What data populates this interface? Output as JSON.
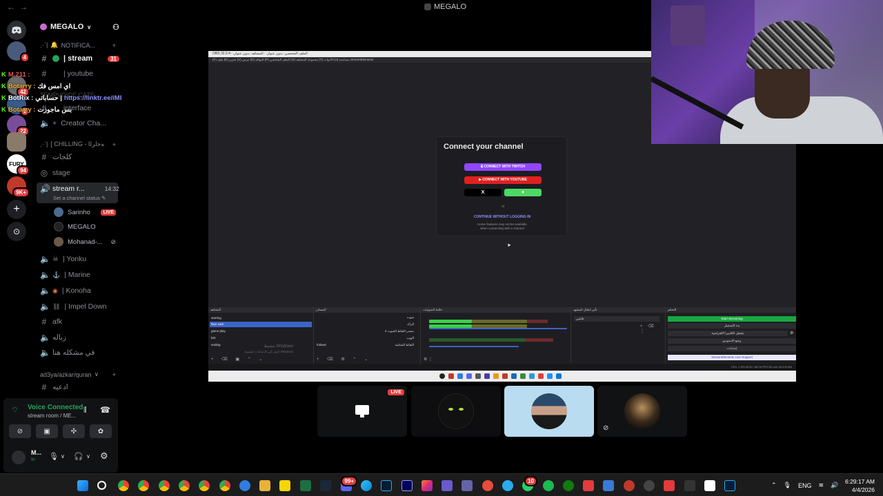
{
  "window": {
    "title": "MEGALO",
    "nav_back": "←",
    "nav_forward": "→"
  },
  "server": {
    "name": "MEGALO",
    "chevron": "∨"
  },
  "rail_badges": [
    "4",
    "42",
    "1",
    "22",
    "94",
    "9K+"
  ],
  "rail_labels": {
    "fury": "FURY"
  },
  "categories": {
    "notifications": "NOTIFICA...",
    "temp_voice": "TEMPVOICE CATE...",
    "chilling": "[ CHILLING - ﻪﺣﺍﺮﻟﺍ",
    "quran": "ad3ya/azkar/quran"
  },
  "channels": {
    "stream": {
      "name": "| stream",
      "count": "31"
    },
    "youtube": "| youtube",
    "interface": "interface",
    "creator": "Creator Cha...",
    "kalajat": "ﻛﻠﺠﺎﺕ",
    "stage": "stage",
    "stream_room": {
      "name": "stream r...",
      "time": "14:32",
      "status": "Set a channel status"
    },
    "yonku": "| Yonku",
    "marine": "| Marine",
    "konoha": "| Konoha",
    "impel": "| Impel Down",
    "afk": "afk",
    "zbala": "ﺯﺑﺎﻟﻪ",
    "mushkila": "ﻓﻲ ﻣﺸﻜﻠﻪ ﻫﻨﺎ",
    "adeia": "ﺍﺩﻋﻴﻪ"
  },
  "users": {
    "sarinho": "Sarinho",
    "live": "LIVE",
    "megalo": "MEGALO",
    "mohanad": "Mohanad-..."
  },
  "chat": [
    {
      "user": "M.211 :",
      "msg": "ﺍﻱ ﺍﻣﺲ ﻓﻚ",
      "color": "#e05a5a"
    },
    {
      "user": "Botarry :",
      "msg": "",
      "color": "#f0b232"
    },
    {
      "user": "BotRix :",
      "msg": "ﺣﺴﺎﺑﺎﺗﻲ | https://linktr.ee/iMEGALO",
      "color": "#ffffff",
      "link_color": "#8e90ff"
    },
    {
      "user": "Botarry :",
      "msg": "ﺑﺲ ﻣﺎﺟﻮﺯﺕ",
      "color": "#f0b232"
    }
  ],
  "voice": {
    "title": "Voice Connected",
    "sub": "stream room / ME...",
    "user": "M...",
    "status": "In"
  },
  "obs": {
    "topbar": "OBS 32.0.4 - ﺍﻟﻤﻠﻒ ﺍﻟﺸﺨﺼﻲ: ﺑﺪﻭﻥ ﻋﻨﻮﺍﻥ - ﺍﻟﻤﺸﺎﻫﺪ: ﺑﺪﻭﻥ ﻋﻨﻮﺍﻥ",
    "menu": "(F) ﻣﻠﻒ   (E) ﺗﺤﺮﻳﺮ   (V) ﻋﺮﺽ   (D) ﺍﻟﻨﻮﺍﻓﺬ   (P) ﺍﻟﻤﻠﻒ ﺍﻟﺸﺨﺼﻲ   (S) ﻣﺠﻤﻮﻋﺔ ﺍﻟﻤﺸﺎﻫﺪ   (T) ﺍﻷﺩﻭﺍﺕ   (H) ﻣﺴﺎﻋﺪﺓ   StreamElements",
    "connect": {
      "title": "Connect your channel",
      "twitch": "CONNECT WITH TWITCH",
      "youtube": "CONNECT WITH YOUTUBE",
      "x": "X",
      "or": "or",
      "continue": "CONTINUE WITHOUT LOGGING IN",
      "note1": "Some features may not be available",
      "note2": "when connecting with a channel"
    },
    "docks": {
      "scenes_header": "ﺍﻟﻤﺸﺎﻫﺪ",
      "sources_header": "ﺍﻟﻤﺼﺎﺩﺭ",
      "mixer_header": "ﺧﻼﻁ ﺍﻟﺼﻮﺗﻴﺎﺕ",
      "transitions_header": "ﺗﺄﺛﻴﺮ ﺍﻧﺘﻘﺎﻝ ﺍﻟﻤﺸﻬﺪ",
      "controls_header": "ﺍﻟﺘﺤﻜﻢ",
      "scenes": [
        "starting",
        "face cam",
        "game play",
        "brb",
        "ending"
      ],
      "selected_scene": 1,
      "sources": [
        "ﺻﻮﺕ",
        "ﺍﻟﺮﺍﻙ",
        "ﻣﺼﺪﺭ ﺍﻟﺘﻘﺎﻁ ﺍﻟﺼﻮﺕ 2",
        "ﺍﻟﻮﻳﺐ",
        "follows",
        "ﺍﻟﺘﻘﺎﻁ ﺍﻟﺸﺎﺷﺔ"
      ],
      "start_streaming": "Start Streaming",
      "controls": [
        "ﺑﺪﺀ ﺍﻟﺘﺴﺠﻴﻞ",
        "ﺗﺸﻐﻴﻞ ﺍﻟﻜﺎﻣﻴﺮﺍ ﺍﻻﻓﺘﺮﺍﺿﻴﺔ",
        "ﻭﺿﻊ ﺍﻻﺳﺘﻮﺩﻳﻮ",
        "ﺇﻋﺪﺍﺩﺍﺕ"
      ],
      "se_support": "StreamElements Live Support",
      "fade": "ﺗﻼﺷﻲ"
    },
    "status": "CPU: 2.9%   60.00 / 60.00 FPS   35 Live: 00:2:5:549",
    "watermark1": "ﺗﻨﺸﻴﻂ Windows",
    "watermark2": "ﺍﻧﺘﻘﻞ ﺇﻟﻰ ﺍﻹﻋﺪﺍﺩﺍﺕ ﻟﺘﻨﺸﻴﻂ Windows"
  },
  "tiles": {
    "live": "LIVE"
  },
  "taskbar": {
    "lang": "ENG",
    "time": "6:29:17 AM",
    "date": "4/4/2026",
    "badge1": "99+",
    "badge2": "10"
  },
  "colors": {
    "accent_live": "#e23c3c",
    "voice_green": "#23a559",
    "twitch": "#9146ff",
    "youtube": "#e02020",
    "selected_tile": "#b9dcf0",
    "obs_start": "#19a840"
  }
}
